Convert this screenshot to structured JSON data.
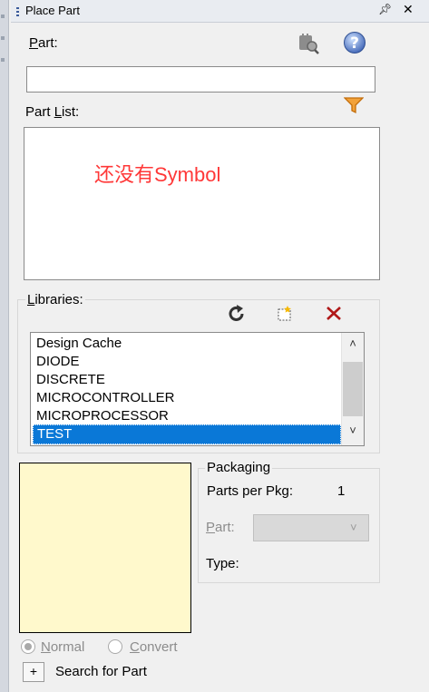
{
  "window": {
    "title": "Place Part"
  },
  "part": {
    "label": "Part:",
    "label_underline": "P",
    "label_rest": "art:",
    "value": ""
  },
  "part_list": {
    "label_pre": "Part ",
    "label_underline": "L",
    "label_rest": "ist:",
    "placeholder_note": "还没有Symbol"
  },
  "libraries": {
    "label_underline": "L",
    "label_rest": "ibraries:",
    "items": [
      "Design Cache",
      "DIODE",
      "DISCRETE",
      "MICROCONTROLLER",
      "MICROPROCESSOR",
      "TEST"
    ],
    "selected": "TEST"
  },
  "packaging": {
    "title": "Packaging",
    "parts_per_pkg_label": "Parts per Pkg:",
    "parts_per_pkg_value": "1",
    "part_label_underline": "P",
    "part_label_rest": "art:",
    "part_value": "",
    "type_label": "Type:",
    "type_value": ""
  },
  "view_mode": {
    "normal_underline": "N",
    "normal_rest": "ormal",
    "convert_underline": "C",
    "convert_rest": "onvert",
    "selected": "Normal"
  },
  "search": {
    "button_label": "+",
    "label": "Search for Part"
  },
  "colors": {
    "selection": "#0a78d7",
    "preview_bg": "#fff9cc",
    "annotation": "#ff3838",
    "filter_icon": "#e07a10"
  },
  "icons": [
    "pin-icon",
    "close-icon",
    "parts-search-icon",
    "help-icon",
    "filter-icon",
    "refresh-icon",
    "add-library-icon",
    "remove-library-icon"
  ]
}
